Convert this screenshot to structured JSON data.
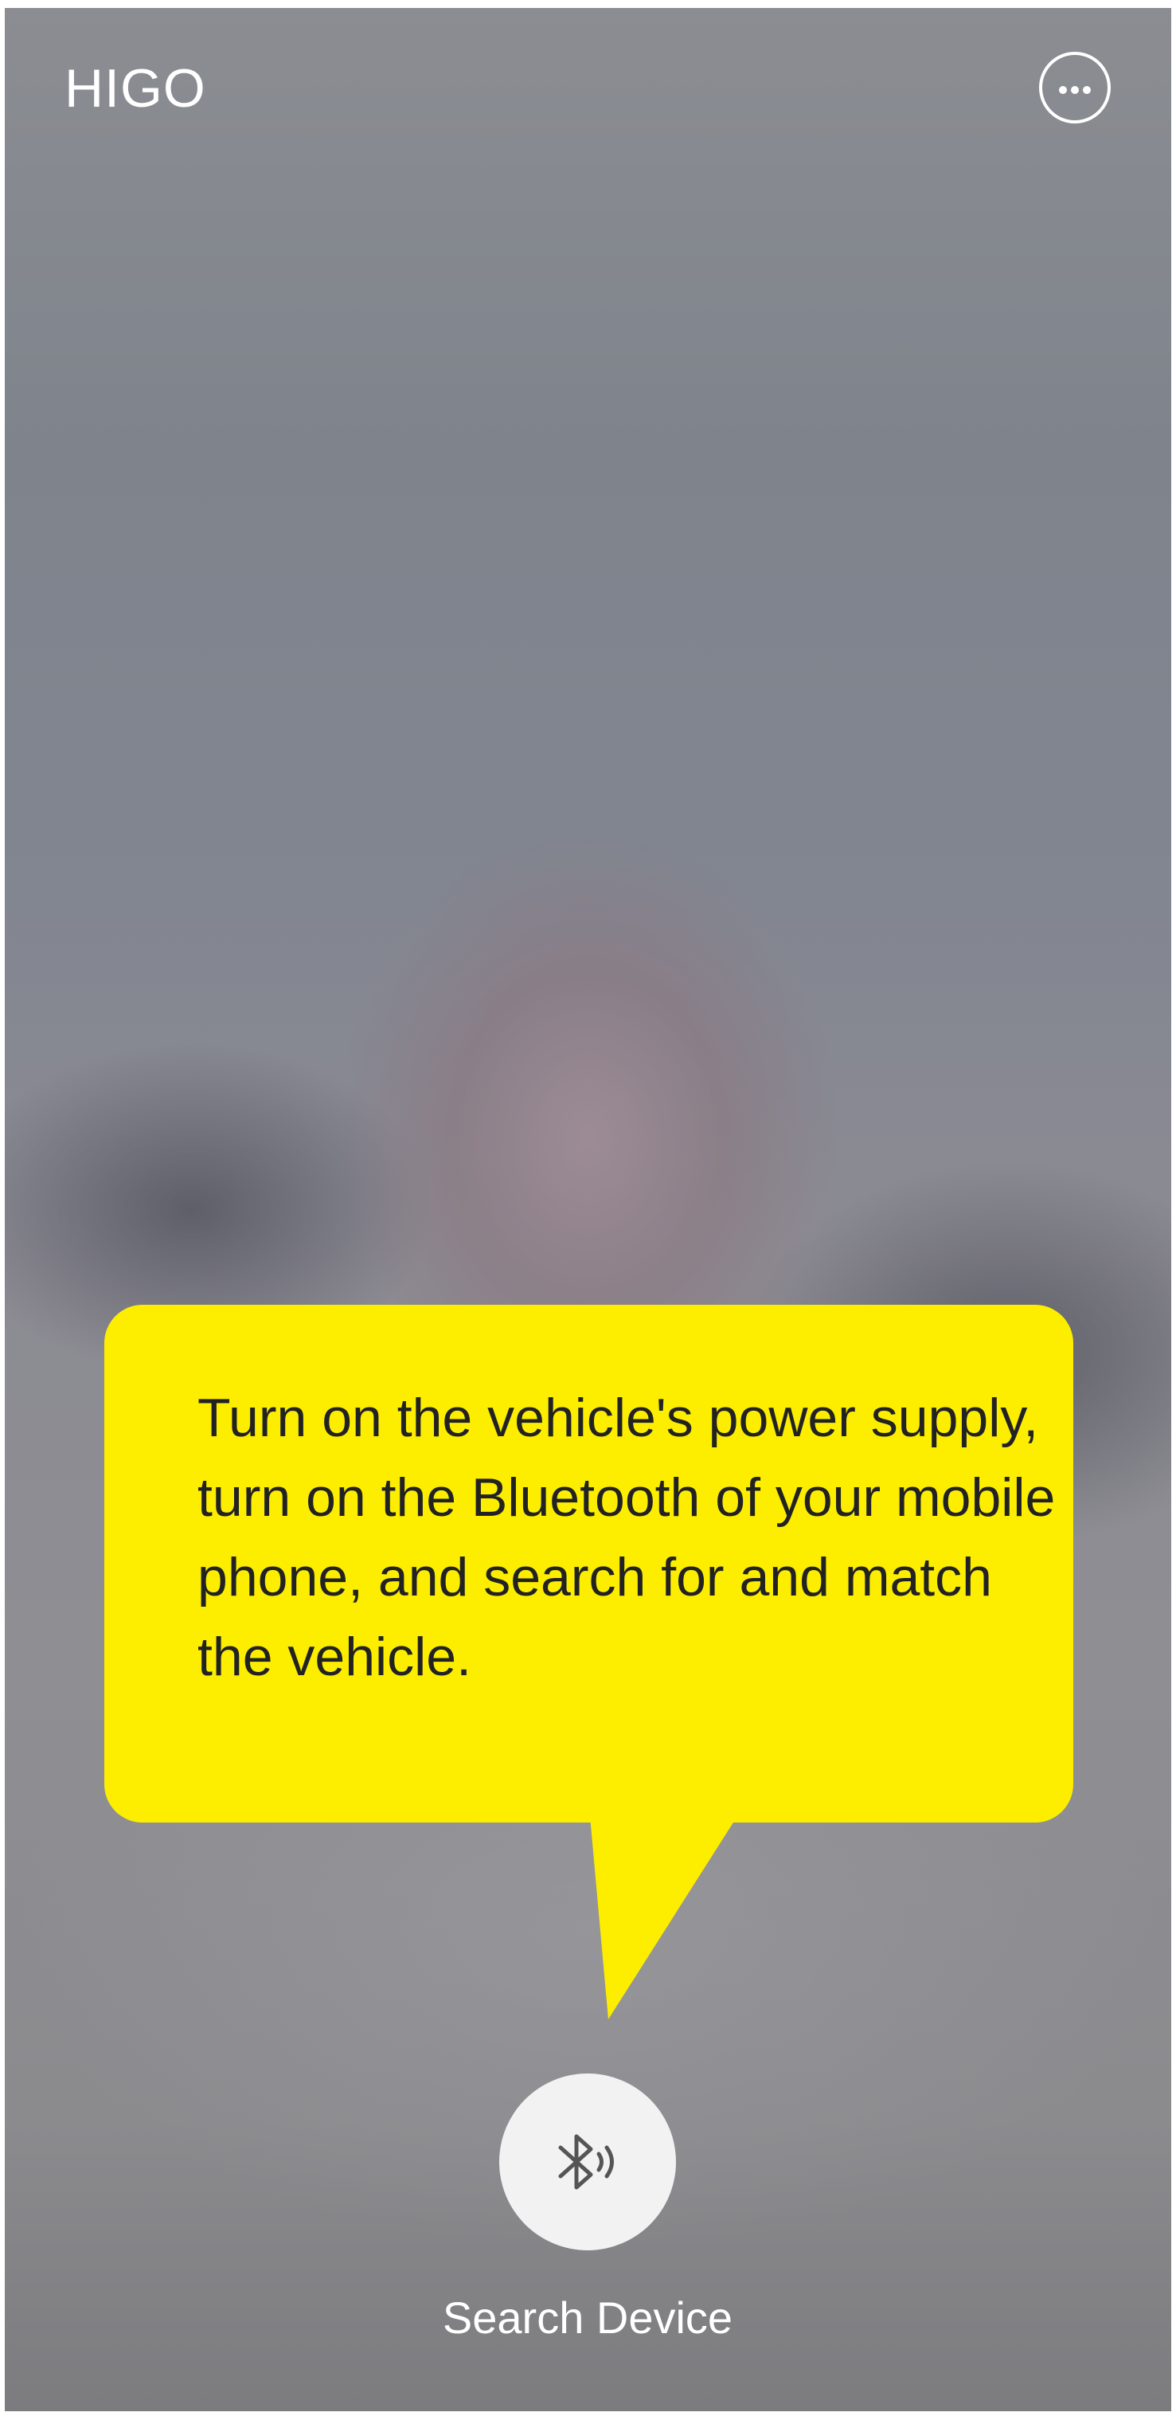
{
  "header": {
    "title": "HIGO",
    "more_icon": "more-horizontal-circle-icon"
  },
  "tooltip": {
    "text": "Turn on the vehicle's power supply, turn on the Bluetooth of your mobile phone, and search for and match the vehicle.",
    "background_color": "#fdee00"
  },
  "search": {
    "icon": "bluetooth-searching-icon",
    "label": "Search Device"
  }
}
